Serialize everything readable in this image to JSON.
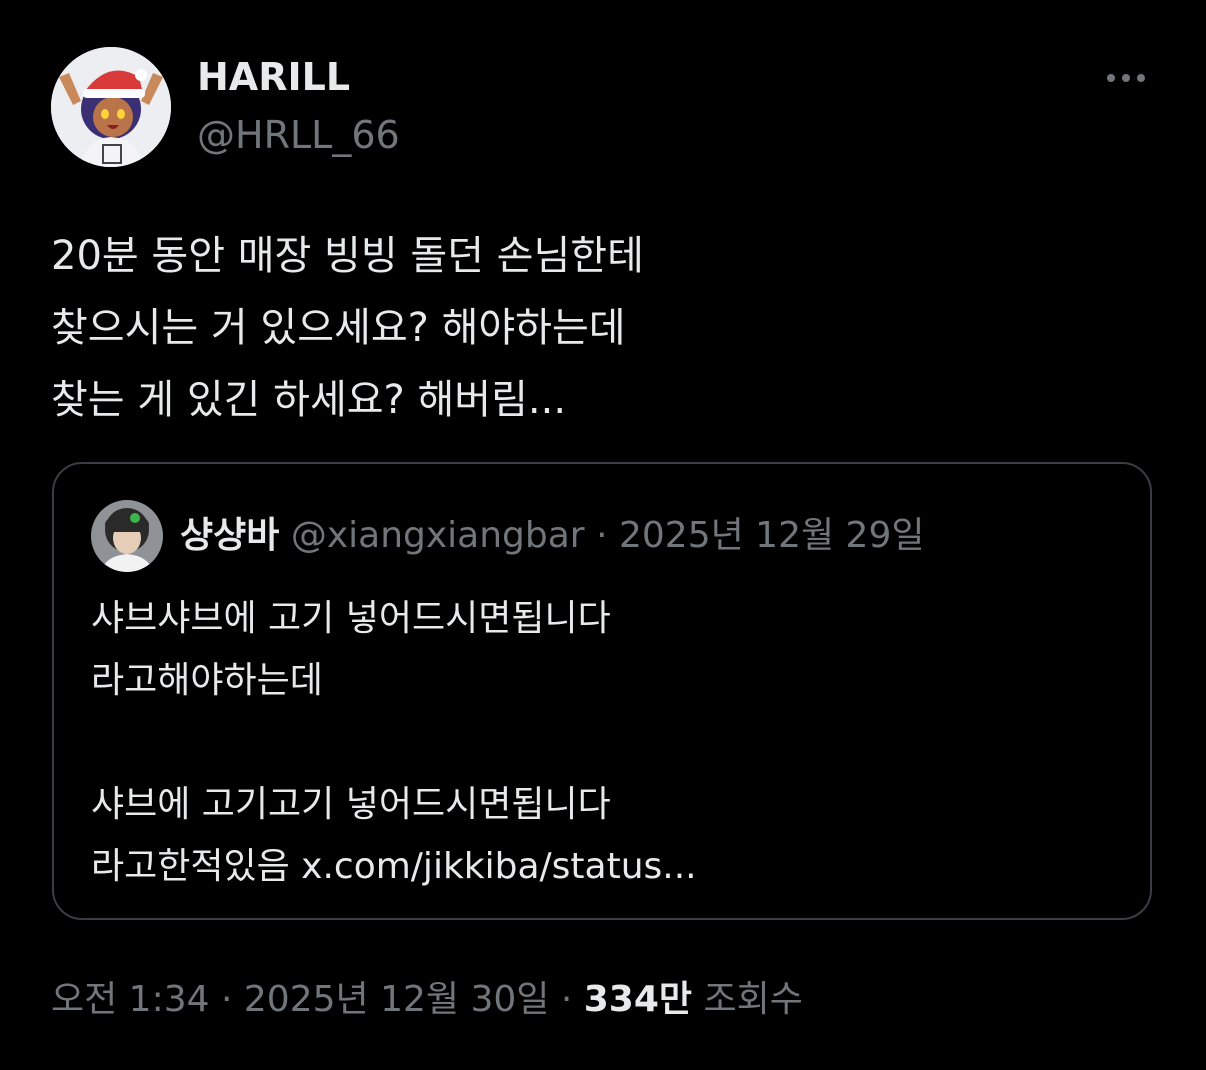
{
  "author": {
    "display_name": "HARILL",
    "handle": "@HRLL_66",
    "avatar_icon": "anime-character-santa-hat-avatar"
  },
  "more_icon": "more-horizontal-icon",
  "tweet": {
    "lines": [
      "20분 동안 매장 빙빙 돌던 손님한테",
      "찾으시는 거 있으세요? 해야하는데",
      "찾는 게 있긴 하세요? 해버림..."
    ]
  },
  "quote": {
    "display_name": "샹샹바",
    "handle": "@xiangxiangbar",
    "separator": "·",
    "date": "2025년 12월 29일",
    "avatar_icon": "person-photo-avatar",
    "lines": [
      "샤브샤브에 고기 넣어드시면됩니다",
      "라고해야하는데",
      "",
      "샤브에 고기고기 넣어드시면됩니다"
    ],
    "last_line_text": "라고한적있음 ",
    "link": "x.com/jikkiba/status..."
  },
  "meta": {
    "time": "오전 1:34",
    "separator": "·",
    "date": "2025년 12월 30일",
    "views_count": "334만",
    "views_label": "조회수"
  },
  "colors": {
    "background": "#000000",
    "primary_text": "#e7e9ea",
    "secondary_text": "#71767b",
    "border": "#3a3d41",
    "santa_hat": "#d93a3a"
  }
}
